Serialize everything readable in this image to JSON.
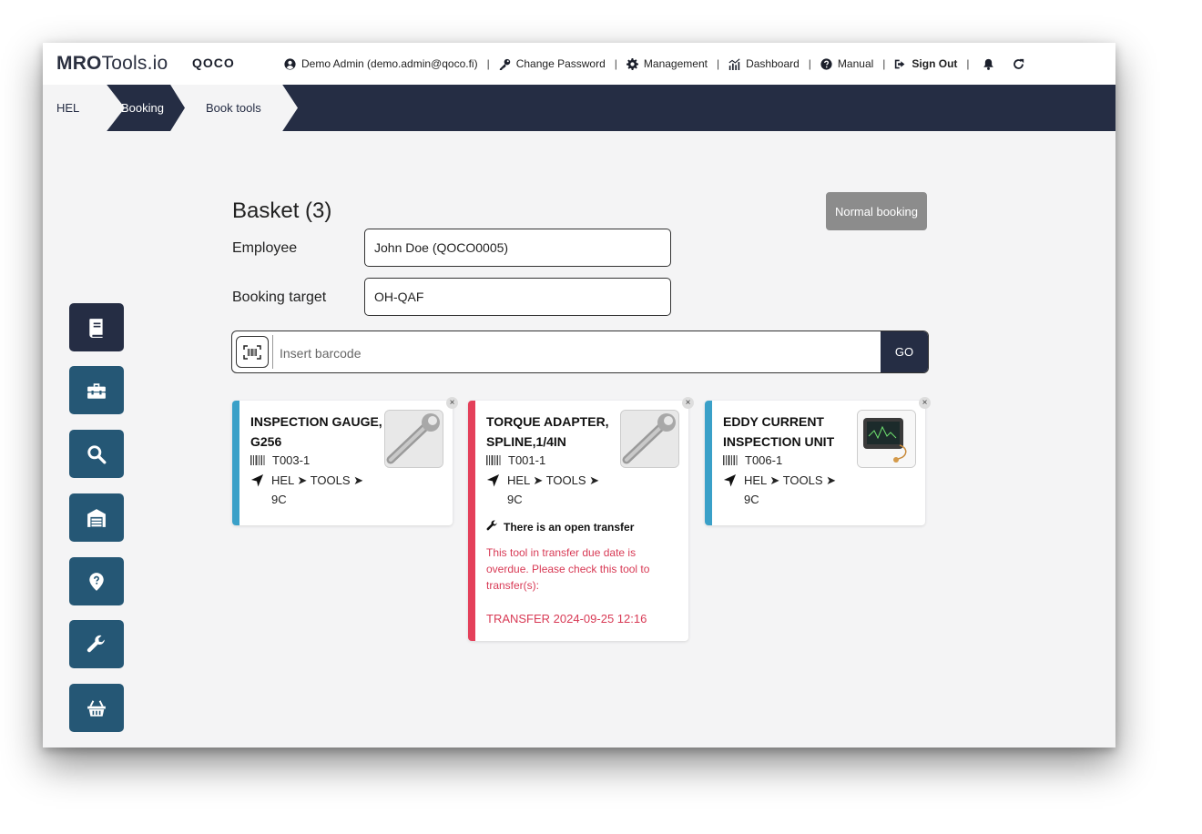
{
  "header": {
    "logo_bold": "MRO",
    "logo_rest": "Tools.io",
    "brand": "QOCO",
    "user": "Demo Admin (demo.admin@qoco.fi)",
    "change_password": "Change Password",
    "management": "Management",
    "dashboard": "Dashboard",
    "manual": "Manual",
    "sign_out": "Sign Out",
    "separator": "|"
  },
  "breadcrumb": [
    "HEL",
    "Booking",
    "Book tools"
  ],
  "sidebar": [
    {
      "icon": "book-icon",
      "active": true
    },
    {
      "icon": "toolbox-icon"
    },
    {
      "icon": "search-icon"
    },
    {
      "icon": "warehouse-icon"
    },
    {
      "icon": "location-question-icon"
    },
    {
      "icon": "wrench-icon"
    },
    {
      "icon": "basket-icon"
    }
  ],
  "basket": {
    "title": "Basket (3)",
    "normal_booking": "Normal booking",
    "employee_label": "Employee",
    "employee_value": "John Doe (QOCO0005)",
    "target_label": "Booking target",
    "target_value": "OH-QAF",
    "barcode_placeholder": "Insert barcode",
    "go": "GO"
  },
  "cards": [
    {
      "name": "INSPECTION GAUGE, G256",
      "id": "T003-1",
      "location": "HEL ➤ TOOLS ➤ 9C",
      "status_color": "#3aa0c8",
      "close": "×"
    },
    {
      "name": "TORQUE ADAPTER, SPLINE,1/4IN",
      "id": "T001-1",
      "location": "HEL ➤ TOOLS ➤ 9C",
      "status_color": "#e4405a",
      "warning": "There is an open transfer",
      "overdue_text": "This tool in transfer due date is overdue. Please check this tool to transfer(s):",
      "transfer_link": "TRANSFER 2024-09-25 12:16",
      "close": "×"
    },
    {
      "name": "EDDY CURRENT INSPECTION UNIT",
      "id": "T006-1",
      "location": "HEL ➤ TOOLS ➤ 9C",
      "status_color": "#3aa0c8",
      "close": "×"
    }
  ]
}
